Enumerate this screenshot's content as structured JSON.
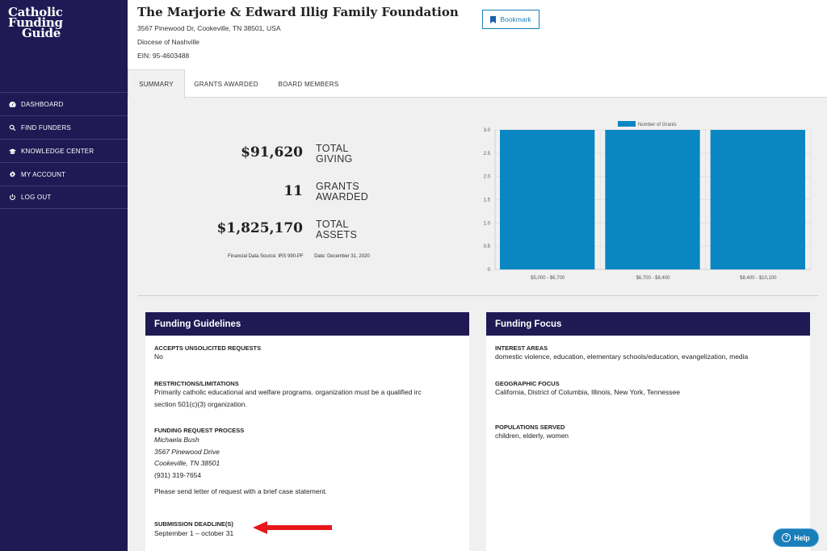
{
  "sidebar": {
    "logo": [
      "Catholic",
      "Funding",
      "Guide"
    ],
    "items": [
      {
        "label": "DASHBOARD",
        "icon": "dashboard-icon"
      },
      {
        "label": "FIND FUNDERS",
        "icon": "search-icon"
      },
      {
        "label": "KNOWLEDGE CENTER",
        "icon": "graduation-cap-icon"
      },
      {
        "label": "MY ACCOUNT",
        "icon": "gear-icon"
      },
      {
        "label": "LOG OUT",
        "icon": "power-icon"
      }
    ]
  },
  "header": {
    "title": "The Marjorie & Edward Illig Family Foundation",
    "address": "3567 Pinewood Dr, Cookeville, TN 38501, USA",
    "diocese": "Diocese of Nashville",
    "ein": "EIN: 95-4603488",
    "bookmark_label": "Bookmark"
  },
  "tabs": [
    {
      "label": "SUMMARY",
      "active": true
    },
    {
      "label": "GRANTS AWARDED",
      "active": false
    },
    {
      "label": "BOARD MEMBERS",
      "active": false
    }
  ],
  "summary": {
    "total_giving": {
      "value": "$91,620",
      "label1": "TOTAL",
      "label2": "GIVING"
    },
    "grants_awarded": {
      "value": "11",
      "label1": "GRANTS",
      "label2": "AWARDED"
    },
    "total_assets": {
      "value": "$1,825,170",
      "label1": "TOTAL",
      "label2": "ASSETS"
    },
    "source": "Financial Data Source: IRS 990-PF",
    "date": "Date: December 31, 2020"
  },
  "chart_data": {
    "type": "bar",
    "categories": [
      "$5,000 - $6,700",
      "$6,700 - $8,400",
      "$8,400 - $10,100"
    ],
    "series": [
      {
        "name": "Number of Grants",
        "values": [
          3,
          3,
          3
        ]
      }
    ],
    "ylim": [
      0,
      3
    ],
    "yticks": [
      "0",
      "0.5",
      "1.0",
      "1.5",
      "2.0",
      "2.5",
      "3.0"
    ],
    "legend_position": "top",
    "color": "#0a86c2",
    "grid": true
  },
  "funding_guidelines": {
    "title": "Funding Guidelines",
    "unsolicited_title": "ACCEPTS UNSOLICITED REQUESTS",
    "unsolicited_value": "No",
    "restrictions_title": "RESTRICTIONS/LIMITATIONS",
    "restrictions_line1": "Primarily catholic educational and welfare programs. organization must be a qualified irc",
    "restrictions_line2": "section 501(c)(3) organization.",
    "process_title": "FUNDING REQUEST PROCESS",
    "contact_name": "Michaela Bush",
    "contact_street": "3567 Pinewood Drive",
    "contact_city": "Cookeville, TN 38501",
    "contact_phone": "(931) 319-7654",
    "process_note": "Please send letter of request with a brief case statement.",
    "deadline_title": "SUBMISSION DEADLINE(S)",
    "deadline_value": "September 1 – october 31"
  },
  "funding_focus": {
    "title": "Funding Focus",
    "interest_title": "INTEREST AREAS",
    "interest_value": "domestic violence, education, elementary schools/education, evangelization, media",
    "geo_title": "GEOGRAPHIC FOCUS",
    "geo_value": "California, District of Columbia, Illinois, New York, Tennessee",
    "pop_title": "POPULATIONS SERVED",
    "pop_value": "children, elderly, women"
  },
  "help_label": "Help",
  "colors": {
    "navy": "#1f1a54",
    "accent": "#1a7fb8",
    "bar": "#0a86c2",
    "arrow": "#e8161b"
  }
}
